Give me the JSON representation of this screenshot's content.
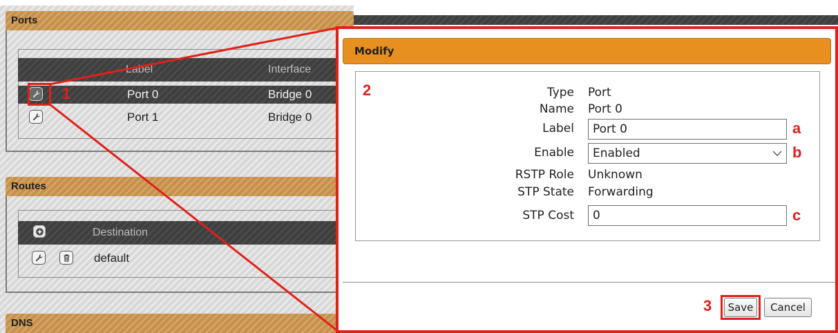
{
  "sections": {
    "ports": {
      "title": "Ports",
      "columns": [
        "Label",
        "Interface"
      ],
      "rows": [
        {
          "label": "Port 0",
          "interface": "Bridge 0",
          "selected": true
        },
        {
          "label": "Port 1",
          "interface": "Bridge 0",
          "selected": false
        }
      ]
    },
    "routes": {
      "title": "Routes",
      "columns": [
        "Destination"
      ],
      "rows": [
        {
          "destination": "default"
        }
      ]
    },
    "dns": {
      "title": "DNS"
    }
  },
  "callouts": {
    "one": "1",
    "two": "2",
    "three": "3",
    "a": "a",
    "b": "b",
    "c": "c"
  },
  "modal": {
    "title": "Modify",
    "fields": {
      "type": {
        "label": "Type",
        "value": "Port"
      },
      "name": {
        "label": "Name",
        "value": "Port 0"
      },
      "label": {
        "label": "Label",
        "value": "Port 0"
      },
      "enable": {
        "label": "Enable",
        "value": "Enabled"
      },
      "rstp_role": {
        "label": "RSTP Role",
        "value": "Unknown"
      },
      "stp_state": {
        "label": "STP State",
        "value": "Forwarding"
      },
      "stp_cost": {
        "label": "STP Cost",
        "value": "0"
      }
    },
    "buttons": {
      "save": "Save",
      "cancel": "Cancel"
    }
  },
  "colors": {
    "highlight": "#e0201a",
    "modal_header": "#e8901f",
    "section_header": "#c8914a"
  },
  "icons": {
    "edit": "wrench-icon",
    "delete": "trash-icon",
    "add": "plus-circle-icon",
    "select_arrow": "chevron-down-icon"
  }
}
